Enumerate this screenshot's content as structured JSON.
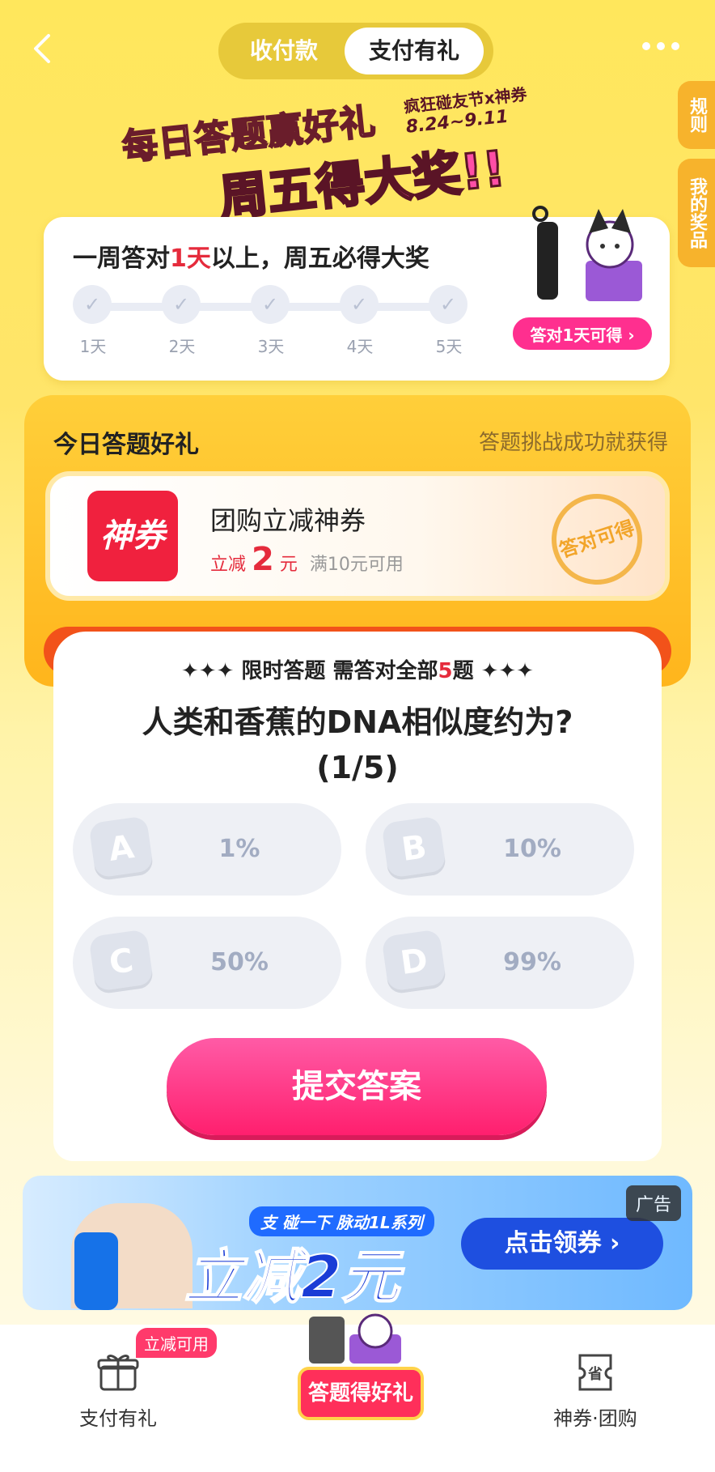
{
  "header": {
    "tabs": [
      {
        "label": "收付款",
        "active": false
      },
      {
        "label": "支付有礼",
        "active": true
      }
    ],
    "icons": [
      "back-icon",
      "more-icon"
    ]
  },
  "side_tabs": [
    "规则",
    "我的奖品"
  ],
  "banner": {
    "title_line1": "每日答题赢好礼",
    "title_line2": "周五得大奖!!",
    "event_name": "疯狂碰友节x神券",
    "event_dates": "8.24~9.11"
  },
  "weekly": {
    "title_prefix": "一周答对",
    "title_highlight": "1天",
    "title_suffix": "以上，周五必得大奖",
    "days": [
      "1天",
      "2天",
      "3天",
      "4天",
      "5天"
    ],
    "prize_button": "答对1天可得 ›"
  },
  "today": {
    "title": "今日答题好礼",
    "subtitle": "答题挑战成功就获得",
    "coupon": {
      "logo_text": "神券",
      "name": "团购立减神券",
      "price_prefix": "立减",
      "price_value": "2",
      "price_unit": "元",
      "condition": "满10元可用",
      "stamp": "答对可得"
    }
  },
  "quiz": {
    "header_prefix": "✦✦✦ 限时答题 需答对全部",
    "header_count": "5",
    "header_suffix": "题 ✦✦✦",
    "question": "人类和香蕉的DNA相似度约为?",
    "progress": "(1/5)",
    "options": [
      {
        "letter": "A",
        "value": "1%"
      },
      {
        "letter": "B",
        "value": "10%"
      },
      {
        "letter": "C",
        "value": "50%"
      },
      {
        "letter": "D",
        "value": "99%"
      }
    ],
    "submit_label": "提交答案"
  },
  "ad": {
    "tag": "广告",
    "brand": "支 碰一下 脉动1L系列",
    "headline": "立减2元",
    "button": "点击领券 ›"
  },
  "bottom_nav": {
    "items": [
      {
        "label": "支付有礼",
        "icon": "gift-icon",
        "badge": "立减可用"
      },
      {
        "label": "答题得好礼",
        "icon": "prize-icon"
      },
      {
        "label": "神券·团购",
        "icon": "coupon-icon"
      }
    ]
  },
  "colors": {
    "accent_pink": "#ff2f8f",
    "accent_red": "#e52b3c",
    "background_yellow": "#ffe75c"
  }
}
